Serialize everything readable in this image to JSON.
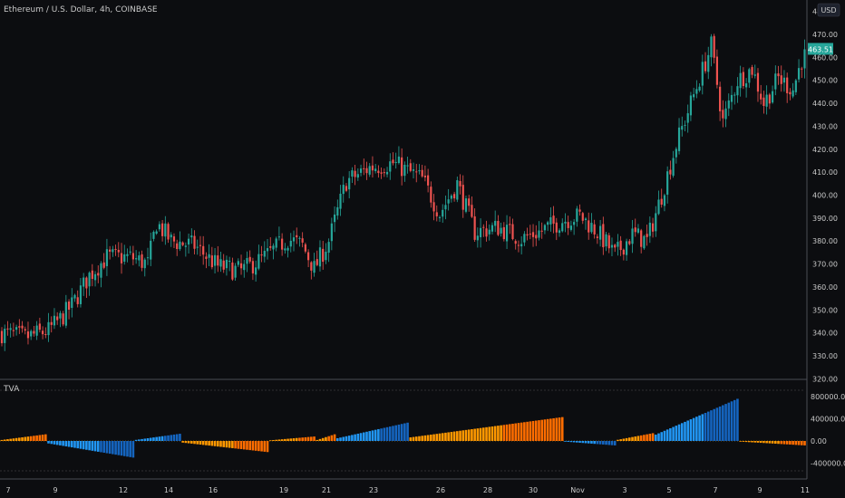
{
  "title": "Ethereum / U.S. Dollar, 4h, COINBASE",
  "currency": "USD",
  "price_badge": "463.51",
  "indicator_label": "TVA",
  "colors": {
    "background": "#0c0d10",
    "up": "#26a69a",
    "down": "#ef5350",
    "tva_light_blue": "#2196f3",
    "tva_dark_blue": "#1565c0",
    "tva_light_orange": "#ff9800",
    "tva_dark_orange": "#ff6d00",
    "badge": "#26a69a",
    "text": "#c8c8c8"
  },
  "chart_data": [
    {
      "type": "candlestick",
      "title": "Ethereum / U.S. Dollar, 4h, COINBASE",
      "y_axis_ticks": [
        "470.00",
        "460.00",
        "450.00",
        "440.00",
        "430.00",
        "420.00",
        "410.00",
        "400.00",
        "390.00",
        "380.00",
        "370.00",
        "360.00",
        "350.00",
        "340.00",
        "330.00",
        "320.00"
      ],
      "ylim": [
        320,
        480
      ],
      "x_axis_ticks": [
        "7",
        "9",
        "12",
        "14",
        "16",
        "19",
        "21",
        "23",
        "26",
        "28",
        "30",
        "Nov",
        "3",
        "5",
        "7",
        "9",
        "11"
      ],
      "close_path": [
        {
          "t": 0,
          "price": 340
        },
        {
          "t": 8,
          "price": 338
        },
        {
          "t": 16,
          "price": 341
        },
        {
          "t": 20,
          "price": 346
        },
        {
          "t": 24,
          "price": 352
        },
        {
          "t": 30,
          "price": 365
        },
        {
          "t": 36,
          "price": 373
        },
        {
          "t": 44,
          "price": 373
        },
        {
          "t": 50,
          "price": 370
        },
        {
          "t": 53,
          "price": 388
        },
        {
          "t": 58,
          "price": 380
        },
        {
          "t": 66,
          "price": 378
        },
        {
          "t": 74,
          "price": 369
        },
        {
          "t": 82,
          "price": 367
        },
        {
          "t": 90,
          "price": 373
        },
        {
          "t": 98,
          "price": 381
        },
        {
          "t": 103,
          "price": 378
        },
        {
          "t": 107,
          "price": 368
        },
        {
          "t": 112,
          "price": 380
        },
        {
          "t": 118,
          "price": 406
        },
        {
          "t": 126,
          "price": 412
        },
        {
          "t": 134,
          "price": 414
        },
        {
          "t": 144,
          "price": 407
        },
        {
          "t": 150,
          "price": 392
        },
        {
          "t": 156,
          "price": 405
        },
        {
          "t": 162,
          "price": 384
        },
        {
          "t": 170,
          "price": 386
        },
        {
          "t": 178,
          "price": 381
        },
        {
          "t": 184,
          "price": 384
        },
        {
          "t": 192,
          "price": 389
        },
        {
          "t": 198,
          "price": 391
        },
        {
          "t": 204,
          "price": 384
        },
        {
          "t": 210,
          "price": 374
        },
        {
          "t": 216,
          "price": 383
        },
        {
          "t": 221,
          "price": 380
        },
        {
          "t": 226,
          "price": 400
        },
        {
          "t": 231,
          "price": 422
        },
        {
          "t": 236,
          "price": 440
        },
        {
          "t": 243,
          "price": 465
        },
        {
          "t": 247,
          "price": 432
        },
        {
          "t": 252,
          "price": 450
        },
        {
          "t": 257,
          "price": 455
        },
        {
          "t": 261,
          "price": 440
        },
        {
          "t": 266,
          "price": 451
        },
        {
          "t": 271,
          "price": 446
        },
        {
          "t": 275,
          "price": 463.51
        }
      ],
      "price_badge": "463.51"
    },
    {
      "type": "bar",
      "title": "TVA",
      "y_axis_ticks": [
        "800000.00",
        "400000.00",
        "0.00",
        "-400000.00"
      ],
      "ylim": [
        -550000,
        800000
      ],
      "segments": [
        {
          "from": 0,
          "to": 15,
          "peak": 120000,
          "side": "up",
          "color": "orange"
        },
        {
          "from": 16,
          "to": 45,
          "peak": -300000,
          "side": "down",
          "color": "blue"
        },
        {
          "from": 46,
          "to": 61,
          "peak": 130000,
          "side": "up",
          "color": "blue"
        },
        {
          "from": 62,
          "to": 91,
          "peak": -200000,
          "side": "down",
          "color": "orange"
        },
        {
          "from": 92,
          "to": 107,
          "peak": 80000,
          "side": "up",
          "color": "orange"
        },
        {
          "from": 108,
          "to": 114,
          "peak": 120000,
          "side": "up",
          "color": "orange"
        },
        {
          "from": 115,
          "to": 139,
          "peak": 330000,
          "side": "up",
          "color": "blue"
        },
        {
          "from": 140,
          "to": 192,
          "peak": 430000,
          "side": "up",
          "color": "orange"
        },
        {
          "from": 193,
          "to": 210,
          "peak": -80000,
          "side": "down",
          "color": "blue"
        },
        {
          "from": 211,
          "to": 223,
          "peak": 140000,
          "side": "up",
          "color": "orange"
        },
        {
          "from": 224,
          "to": 252,
          "peak": 760000,
          "side": "up",
          "color": "blue"
        },
        {
          "from": 253,
          "to": 275,
          "peak": -80000,
          "side": "down",
          "color": "orange"
        }
      ]
    }
  ]
}
